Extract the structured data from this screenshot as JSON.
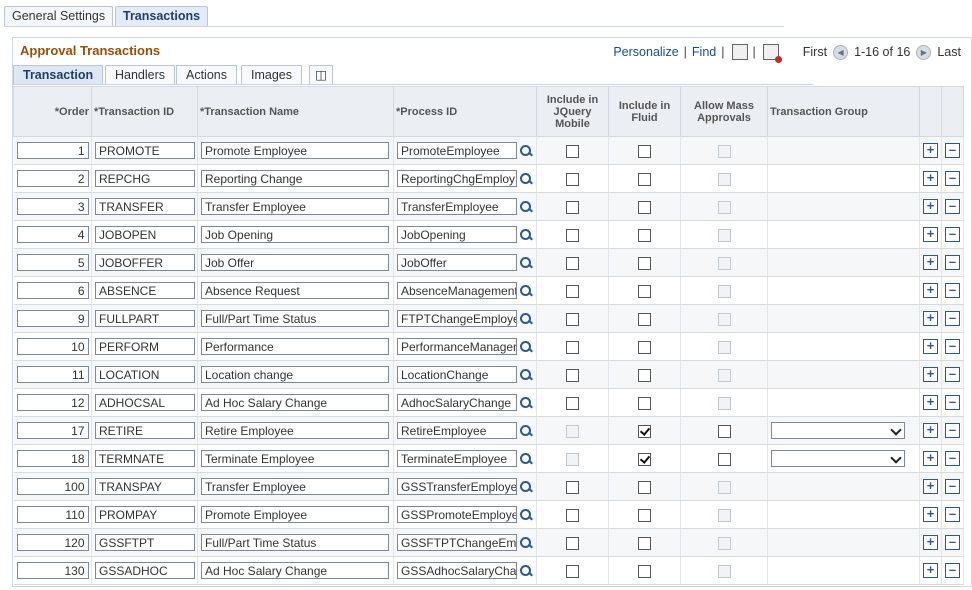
{
  "page_tabs": [
    {
      "label": "General Settings",
      "active": false
    },
    {
      "label": "Transactions",
      "active": true
    }
  ],
  "panel": {
    "title": "Approval Transactions",
    "personalize": "Personalize",
    "find": "Find",
    "first": "First",
    "range": "1-16 of 16",
    "last": "Last"
  },
  "grid_tabs": [
    {
      "label": "Transaction",
      "active": true
    },
    {
      "label": "Handlers",
      "active": false
    },
    {
      "label": "Actions",
      "active": false
    },
    {
      "label": "Images",
      "active": false
    }
  ],
  "columns": {
    "order": "*Order",
    "transaction_id": "*Transaction ID",
    "transaction_name": "*Transaction Name",
    "process_id": "*Process ID",
    "jquery": "Include in JQuery Mobile",
    "fluid": "Include in Fluid",
    "mass": "Allow Mass Approvals",
    "group": "Transaction Group"
  },
  "rows": [
    {
      "order": "1",
      "tid": "PROMOTE",
      "tname": "Promote Employee",
      "pid": "PromoteEmployee",
      "jquery": "unchecked",
      "fluid": "unchecked",
      "mass": "disabled",
      "group": false
    },
    {
      "order": "2",
      "tid": "REPCHG",
      "tname": "Reporting Change",
      "pid": "ReportingChgEmploy",
      "jquery": "unchecked",
      "fluid": "unchecked",
      "mass": "disabled",
      "group": false
    },
    {
      "order": "3",
      "tid": "TRANSFER",
      "tname": "Transfer Employee",
      "pid": "TransferEmployee",
      "jquery": "unchecked",
      "fluid": "unchecked",
      "mass": "disabled",
      "group": false
    },
    {
      "order": "4",
      "tid": "JOBOPEN",
      "tname": "Job Opening",
      "pid": "JobOpening",
      "jquery": "unchecked",
      "fluid": "unchecked",
      "mass": "disabled",
      "group": false
    },
    {
      "order": "5",
      "tid": "JOBOFFER",
      "tname": "Job Offer",
      "pid": "JobOffer",
      "jquery": "unchecked",
      "fluid": "unchecked",
      "mass": "disabled",
      "group": false
    },
    {
      "order": "6",
      "tid": "ABSENCE",
      "tname": "Absence Request",
      "pid": "AbsenceManagement",
      "jquery": "unchecked",
      "fluid": "unchecked",
      "mass": "disabled",
      "group": false
    },
    {
      "order": "9",
      "tid": "FULLPART",
      "tname": "Full/Part Time Status",
      "pid": "FTPTChangeEmploye",
      "jquery": "unchecked",
      "fluid": "unchecked",
      "mass": "disabled",
      "group": false
    },
    {
      "order": "10",
      "tid": "PERFORM",
      "tname": "Performance",
      "pid": "PerformanceManager",
      "jquery": "unchecked",
      "fluid": "unchecked",
      "mass": "disabled",
      "group": false
    },
    {
      "order": "11",
      "tid": "LOCATION",
      "tname": "Location change",
      "pid": "LocationChange",
      "jquery": "unchecked",
      "fluid": "unchecked",
      "mass": "disabled",
      "group": false
    },
    {
      "order": "12",
      "tid": "ADHOCSAL",
      "tname": "Ad Hoc Salary Change",
      "pid": "AdhocSalaryChange",
      "jquery": "unchecked",
      "fluid": "unchecked",
      "mass": "disabled",
      "group": false
    },
    {
      "order": "17",
      "tid": "RETIRE",
      "tname": "Retire Employee",
      "pid": "RetireEmployee",
      "jquery": "disabled",
      "fluid": "checked",
      "mass": "unchecked",
      "group": true
    },
    {
      "order": "18",
      "tid": "TERMNATE",
      "tname": "Terminate Employee",
      "pid": "TerminateEmployee",
      "jquery": "disabled",
      "fluid": "checked",
      "mass": "unchecked",
      "group": true
    },
    {
      "order": "100",
      "tid": "TRANSPAY",
      "tname": "Transfer Employee",
      "pid": "GSSTransferEmploye",
      "jquery": "unchecked",
      "fluid": "unchecked",
      "mass": "disabled",
      "group": false
    },
    {
      "order": "110",
      "tid": "PROMPAY",
      "tname": "Promote Employee",
      "pid": "GSSPromoteEmploye",
      "jquery": "unchecked",
      "fluid": "unchecked",
      "mass": "disabled",
      "group": false
    },
    {
      "order": "120",
      "tid": "GSSFTPT",
      "tname": "Full/Part Time Status",
      "pid": "GSSFTPTChangeEm",
      "jquery": "unchecked",
      "fluid": "unchecked",
      "mass": "disabled",
      "group": false
    },
    {
      "order": "130",
      "tid": "GSSADHOC",
      "tname": "Ad Hoc Salary Change",
      "pid": "GSSAdhocSalaryCha",
      "jquery": "unchecked",
      "fluid": "unchecked",
      "mass": "disabled",
      "group": false
    }
  ],
  "icons": {
    "lookup": "magnifier-icon",
    "add_row": "plus-icon",
    "delete_row": "minus-icon"
  },
  "colors": {
    "title": "#9a4f08",
    "link": "#1a4e8c"
  }
}
